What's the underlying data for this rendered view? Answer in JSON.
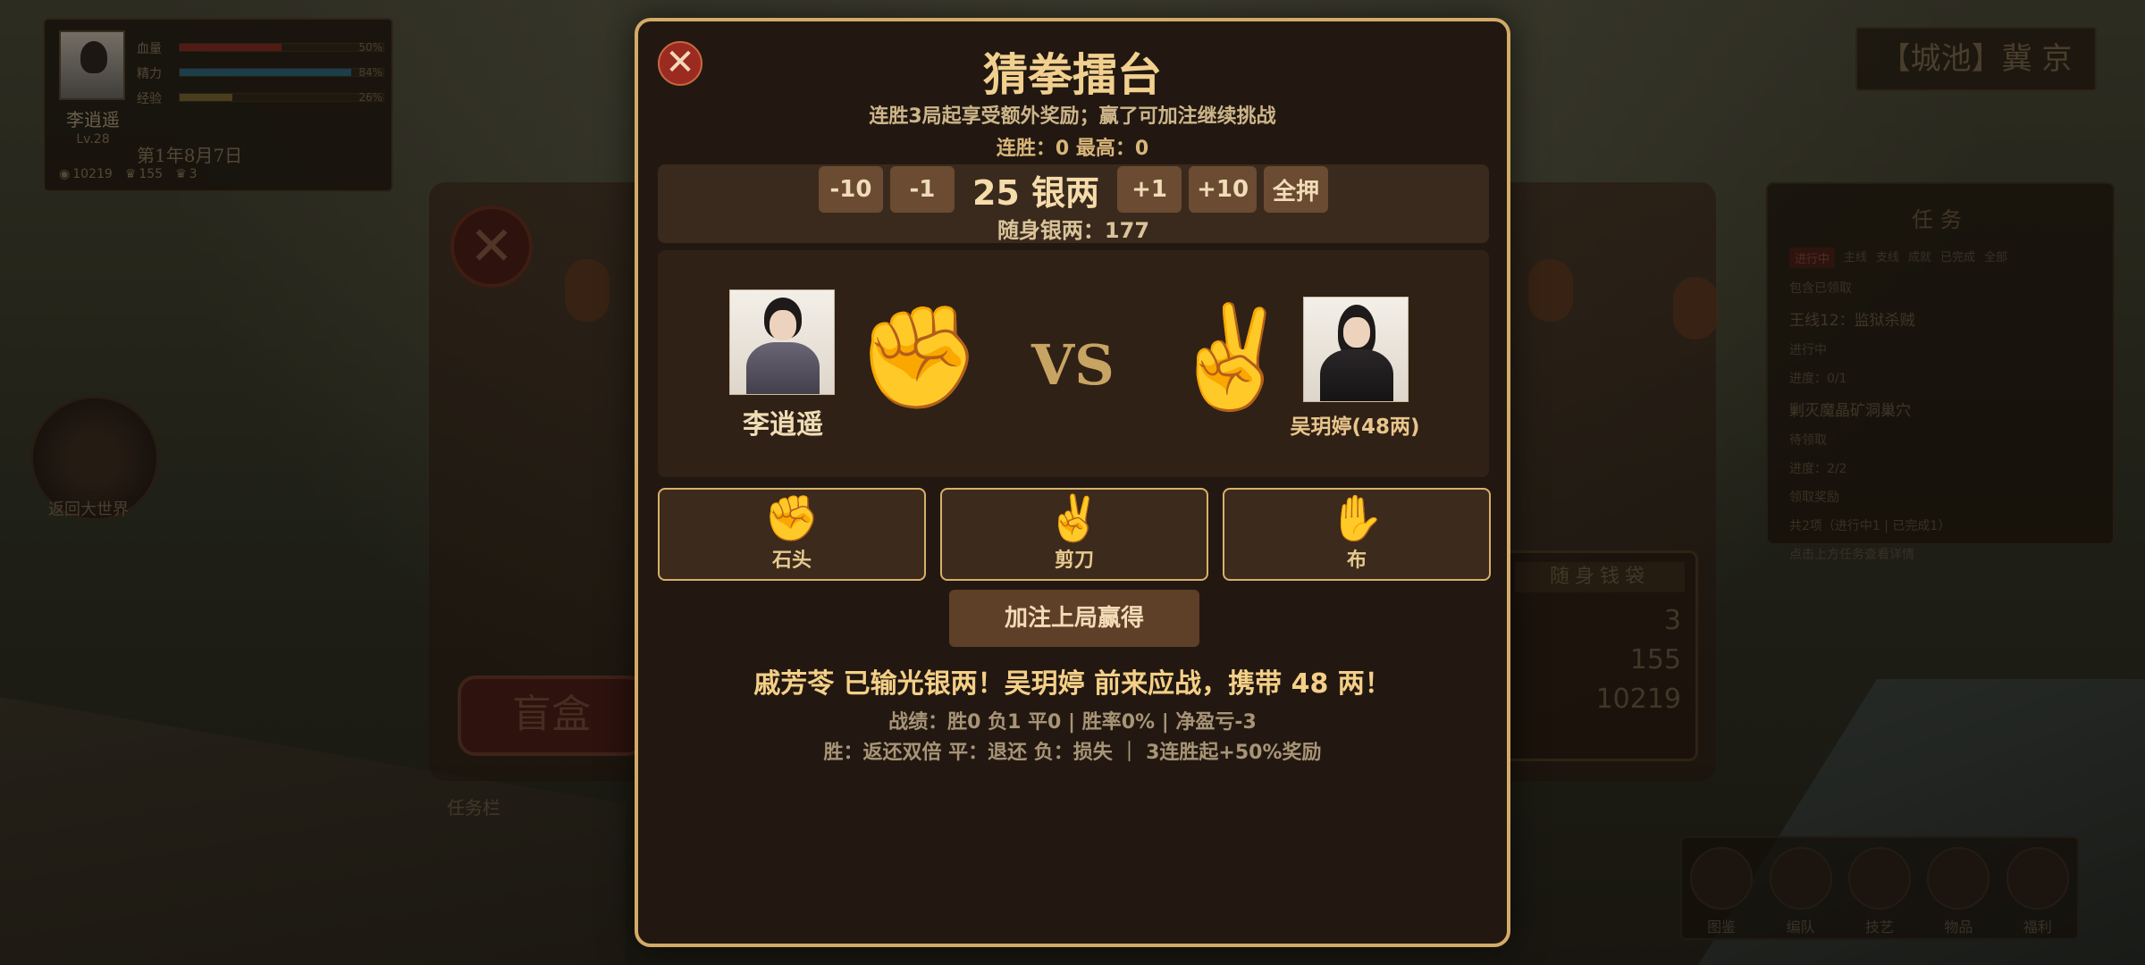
{
  "hud": {
    "name": "李逍遥",
    "level": "Lv.28",
    "stats": [
      {
        "label": "血量",
        "pct": "50%",
        "value": 0.5,
        "color": "#8a2a22"
      },
      {
        "label": "精力",
        "pct": "84%",
        "value": 0.84,
        "color": "#2b6a86"
      },
      {
        "label": "经验",
        "pct": "26%",
        "value": 0.26,
        "color": "#7a6a34"
      }
    ],
    "date": "第1年8月7日",
    "silver": "10219",
    "res2": "155",
    "res3": "3"
  },
  "city": "【城池】冀 京",
  "world_button_label": "返回大世界",
  "shop": {
    "blind_box_label": "盲盒",
    "taskbar_label": "任务栏",
    "purse_title": "随身钱袋",
    "purse_values": [
      "3",
      "155",
      "10219"
    ]
  },
  "quest_panel": {
    "title": "任务",
    "tabs": [
      "进行中",
      "主线",
      "支线",
      "成就",
      "已完成",
      "全部"
    ],
    "show_claimed": "包含已领取",
    "quest1": "王线12：监狱杀贼",
    "quest1_status": "进行中",
    "quest1_progress": "进度：0/1",
    "quest2": "剿灭魔晶矿洞巢穴",
    "quest2_status": "待领取",
    "quest2_progress": "进度：2/2",
    "claim_label": "领取奖励",
    "summary": "共2项（进行中1 | 已完成1）",
    "hint": "点击上方任务查看详情"
  },
  "bottom_menu": [
    "图鉴",
    "编队",
    "技艺",
    "物品",
    "福利"
  ],
  "modal": {
    "title": "猜拳擂台",
    "subtitle": "连胜3局起享受额外奖励；赢了可加注继续挑战",
    "streak": "连胜：0  最高：0",
    "bet_buttons_left": [
      "-10",
      "-1"
    ],
    "bet_amount": "25 银两",
    "bet_buttons_right": [
      "+1",
      "+10",
      "全押"
    ],
    "purse": "随身银两：177",
    "player": {
      "name": "李逍遥",
      "hand": "✊"
    },
    "vs": "VS",
    "opponent": {
      "name": "吴玥婷(48两)",
      "hand": "✌️"
    },
    "choices": [
      {
        "glyph": "✊",
        "label": "石头"
      },
      {
        "glyph": "✌️",
        "label": "剪刀"
      },
      {
        "glyph": "✋",
        "label": "布"
      }
    ],
    "double_label": "加注上局赢得",
    "message": "戚芳苓 已输光银两！吴玥婷 前来应战，携带 48 两！",
    "record": "战绩：胜0 负1 平0 | 胜率0% | 净盈亏-3",
    "rules": "胜：返还双倍  平：退还  负：损失 ｜ 3连胜起+50%奖励"
  }
}
